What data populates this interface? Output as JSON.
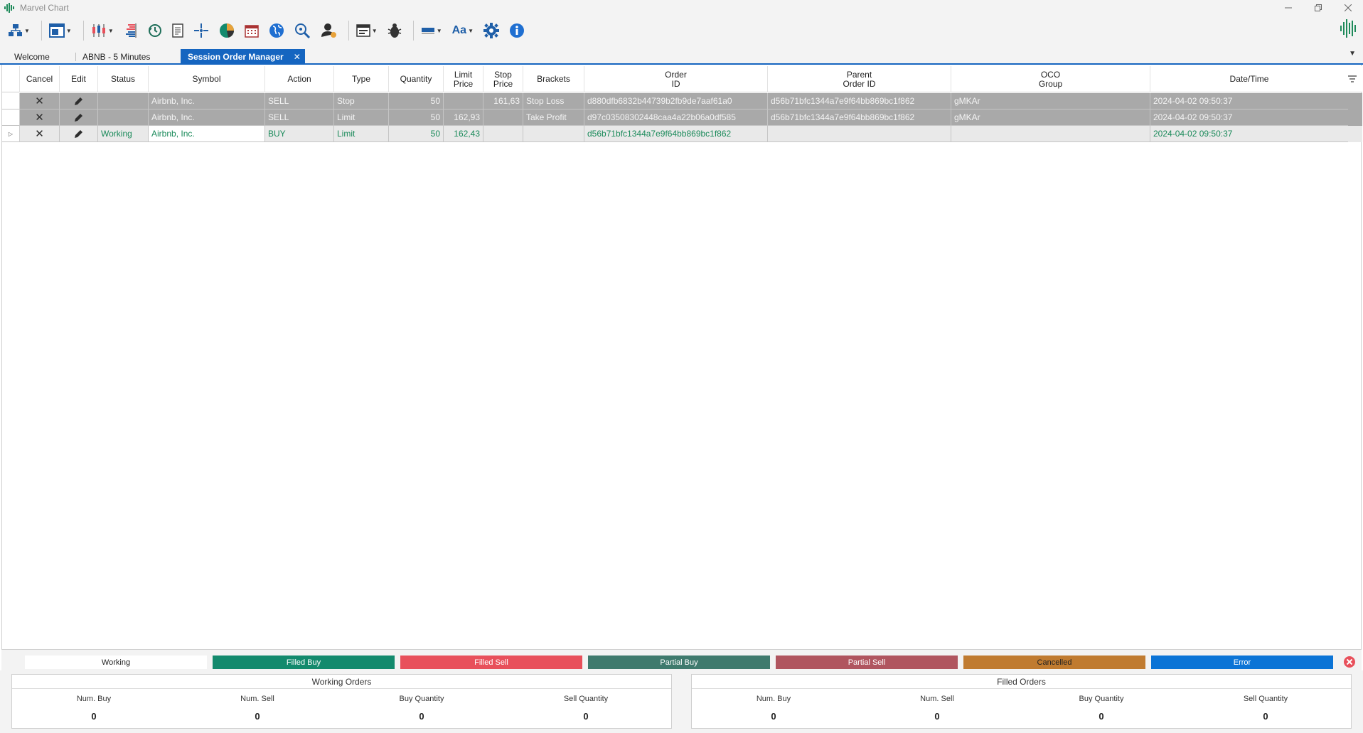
{
  "app": {
    "title": "Marvel Chart"
  },
  "toolbar": {
    "icons": [
      "connection-icon",
      "layout-icon",
      "chart-type-icon",
      "order-book-icon",
      "history-icon",
      "document-icon",
      "crosshair-icon",
      "pie-chart-icon",
      "calendar-icon",
      "globe-icon",
      "scanner-icon",
      "user-settings-icon",
      "window-icon",
      "bug-icon",
      "color-icon",
      "font-icon",
      "gear-icon",
      "info-icon",
      "sound-wave-icon"
    ],
    "font_label": "Aa"
  },
  "tabs": [
    {
      "label": "Welcome"
    },
    {
      "label": "ABNB - 5 Minutes"
    },
    {
      "label": "Session Order Manager"
    }
  ],
  "grid": {
    "headers": {
      "cancel": "Cancel",
      "edit": "Edit",
      "status": "Status",
      "symbol": "Symbol",
      "action": "Action",
      "type": "Type",
      "quantity": "Quantity",
      "limit_price_1": "Limit",
      "limit_price_2": "Price",
      "stop_price_1": "Stop",
      "stop_price_2": "Price",
      "brackets": "Brackets",
      "order_id_1": "Order",
      "order_id_2": "ID",
      "parent_id_1": "Parent",
      "parent_id_2": "Order ID",
      "oco_1": "OCO",
      "oco_2": "Group",
      "datetime": "Date/Time"
    },
    "rows": [
      {
        "status": "",
        "symbol": "Airbnb, Inc.",
        "action": "SELL",
        "type": "Stop",
        "quantity": "50",
        "limit_price": "",
        "stop_price": "161,63",
        "brackets": "Stop Loss",
        "order_id": "d880dfb6832b44739b2fb9de7aaf61a0",
        "parent_id": "d56b71bfc1344a7e9f64bb869bc1f862",
        "oco": "gMKAr",
        "datetime": "2024-04-02 09:50:37"
      },
      {
        "status": "",
        "symbol": "Airbnb, Inc.",
        "action": "SELL",
        "type": "Limit",
        "quantity": "50",
        "limit_price": "162,93",
        "stop_price": "",
        "brackets": "Take Profit",
        "order_id": "d97c03508302448caa4a22b06a0df585",
        "parent_id": "d56b71bfc1344a7e9f64bb869bc1f862",
        "oco": "gMKAr",
        "datetime": "2024-04-02 09:50:37"
      },
      {
        "status": "Working",
        "symbol": "Airbnb, Inc.",
        "action": "BUY",
        "type": "Limit",
        "quantity": "50",
        "limit_price": "162,43",
        "stop_price": "",
        "brackets": "",
        "order_id": "d56b71bfc1344a7e9f64bb869bc1f862",
        "parent_id": "",
        "oco": "",
        "datetime": "2024-04-02 09:50:37"
      }
    ]
  },
  "legend": [
    {
      "label": "Working",
      "color": "#ffffff"
    },
    {
      "label": "Filled Buy",
      "color": "#138a6d"
    },
    {
      "label": "Filled Sell",
      "color": "#e8505b"
    },
    {
      "label": "Partial Buy",
      "color": "#3f7a6d"
    },
    {
      "label": "Partial Sell",
      "color": "#b0555f"
    },
    {
      "label": "Cancelled",
      "color": "#c07b30"
    },
    {
      "label": "Error",
      "color": "#0b74d6"
    }
  ],
  "summary": {
    "working": {
      "title": "Working Orders",
      "num_buy_label": "Num. Buy",
      "num_buy": "0",
      "num_sell_label": "Num. Sell",
      "num_sell": "0",
      "buy_qty_label": "Buy Quantity",
      "buy_qty": "0",
      "sell_qty_label": "Sell Quantity",
      "sell_qty": "0"
    },
    "filled": {
      "title": "Filled Orders",
      "num_buy_label": "Num. Buy",
      "num_buy": "0",
      "num_sell_label": "Num. Sell",
      "num_sell": "0",
      "buy_qty_label": "Buy Quantity",
      "buy_qty": "0",
      "sell_qty_label": "Sell Quantity",
      "sell_qty": "0"
    }
  },
  "colors": {
    "accent": "#1565c0",
    "working_text": "#1a8a5a",
    "bracket_row": "#a9a9a9"
  }
}
